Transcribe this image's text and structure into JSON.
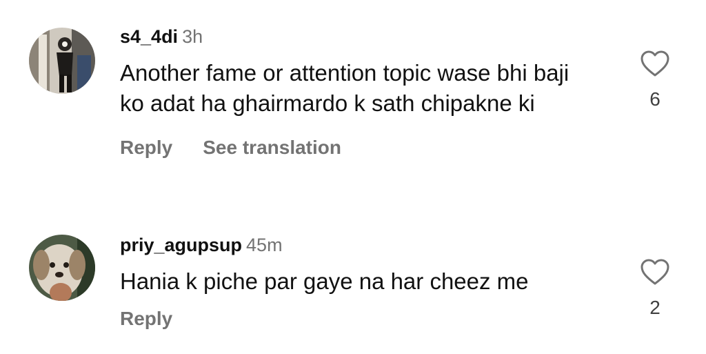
{
  "comments": [
    {
      "username": "s4_4di",
      "time": "3h",
      "text": "Another fame or attention topic wase bhi baji ko adat ha ghairmardo k sath chipakne ki",
      "reply_label": "Reply",
      "translate_label": "See translation",
      "likes": "6",
      "avatar_icon": "profile-photo-person"
    },
    {
      "username": "priy_agupsup",
      "time": "45m",
      "text": "Hania k piche par gaye na har cheez me",
      "reply_label": "Reply",
      "likes": "2",
      "avatar_icon": "profile-photo-dog"
    }
  ],
  "colors": {
    "text": "#111111",
    "secondary": "#737373",
    "count": "#404040"
  }
}
